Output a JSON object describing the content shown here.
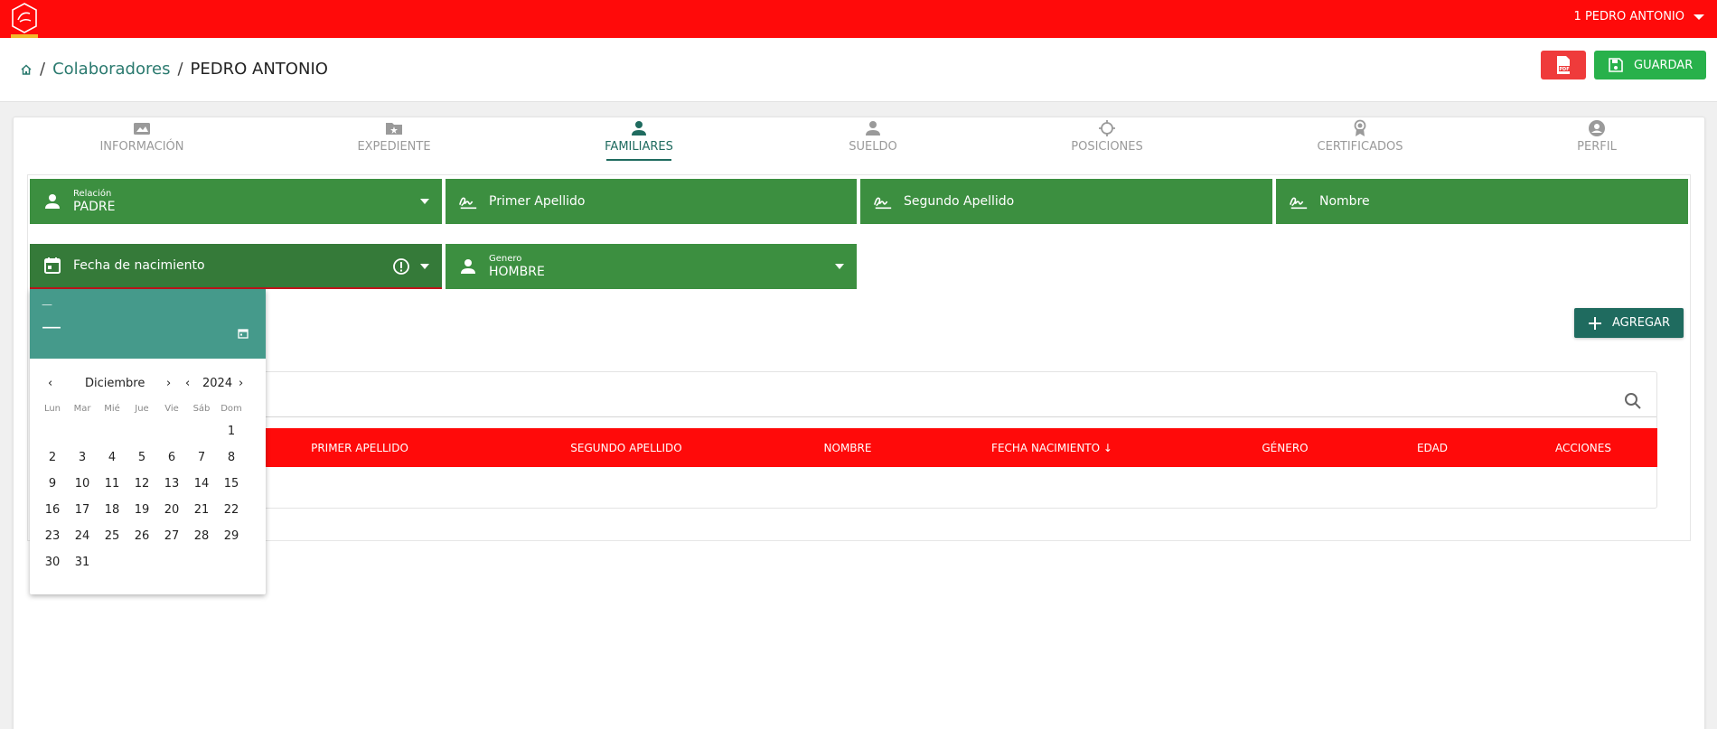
{
  "topbar": {
    "user_name": "1 PEDRO ANTONIO",
    "brand_color": "#ff0a0a"
  },
  "breadcrumb": {
    "link": "Colaboradores",
    "current": "PEDRO ANTONIO",
    "separator": "/"
  },
  "actions": {
    "pdf_icon": "pdf-icon",
    "save_label": "GUARDAR"
  },
  "tabs": [
    {
      "label": "INFORMACIÓN",
      "icon": "id-card-icon",
      "active": false
    },
    {
      "label": "EXPEDIENTE",
      "icon": "folder-star-icon",
      "active": false
    },
    {
      "label": "FAMILIARES",
      "icon": "person-icon",
      "active": true
    },
    {
      "label": "SUELDO",
      "icon": "person-icon",
      "active": false
    },
    {
      "label": "POSICIONES",
      "icon": "crosshair-icon",
      "active": false
    },
    {
      "label": "CERTIFICADOS",
      "icon": "award-icon",
      "active": false
    },
    {
      "label": "PERFIL",
      "icon": "account-circle-icon",
      "active": false
    }
  ],
  "form": {
    "relacion": {
      "label": "Relación",
      "value": "PADRE"
    },
    "primer_apellido": {
      "placeholder": "Primer Apellido"
    },
    "segundo_apellido": {
      "placeholder": "Segundo Apellido"
    },
    "nombre": {
      "placeholder": "Nombre"
    },
    "fecha": {
      "placeholder": "Fecha de nacimiento"
    },
    "genero": {
      "label": "Genero",
      "value": "HOMBRE"
    },
    "field_color": "#3c8f40"
  },
  "add_button": {
    "label": "AGREGAR"
  },
  "table": {
    "columns": [
      "PRIMER APELLIDO",
      "SEGUNDO APELLIDO",
      "NOMBRE",
      "FECHA NACIMIENTO",
      "GÉNERO",
      "EDAD",
      "ACCIONES"
    ],
    "sort_arrow": "↓"
  },
  "datepicker": {
    "header_top": "—",
    "header_main": "—",
    "month": "Diciembre",
    "year": "2024",
    "weekdays": [
      "Lun",
      "Mar",
      "Mié",
      "Jue",
      "Vie",
      "Sáb",
      "Dom"
    ],
    "days": [
      "1",
      "2",
      "3",
      "4",
      "5",
      "6",
      "7",
      "8",
      "9",
      "10",
      "11",
      "12",
      "13",
      "14",
      "15",
      "16",
      "17",
      "18",
      "19",
      "20",
      "21",
      "22",
      "23",
      "24",
      "25",
      "26",
      "27",
      "28",
      "29",
      "30",
      "31"
    ],
    "first_weekday_index": 6,
    "header_color": "#459a8b"
  }
}
